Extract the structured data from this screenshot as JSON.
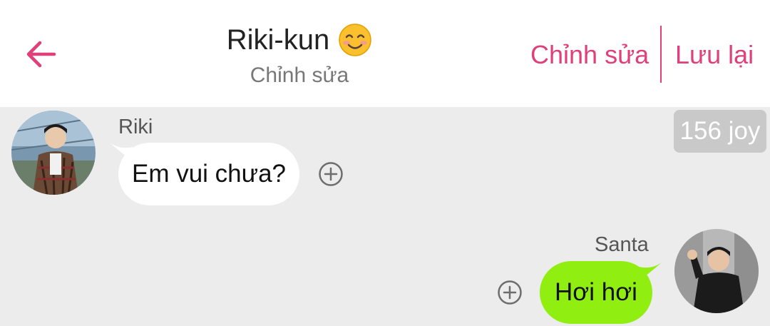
{
  "header": {
    "title": "Riki-kun",
    "subtitle": "Chỉnh sửa",
    "edit_label": "Chỉnh sửa",
    "save_label": "Lưu lại",
    "accent_color": "#e0407a"
  },
  "icons": {
    "back": "arrow-left-icon",
    "title_emoji": "smiling-face-emoji",
    "reaction": "plus-circle-icon"
  },
  "badge": {
    "text": "156 joy"
  },
  "messages": [
    {
      "sender": "Riki",
      "text": "Em vui chưa?",
      "side": "left",
      "bubble_color": "#ffffff"
    },
    {
      "sender": "Santa",
      "text": "Hơi hơi",
      "side": "right",
      "bubble_color": "#90ee10"
    }
  ]
}
